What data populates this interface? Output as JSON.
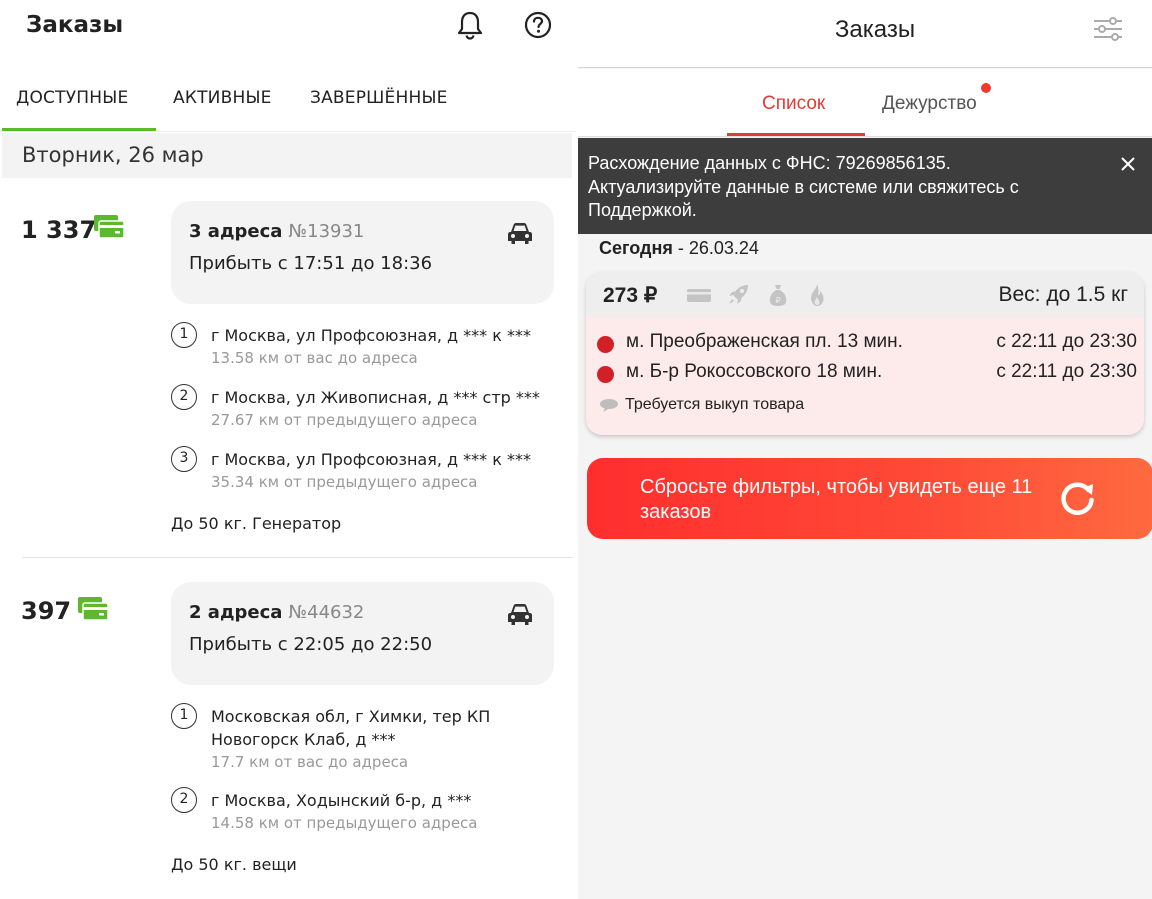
{
  "left": {
    "title": "Заказы",
    "tabs": [
      "ДОСТУПНЫЕ",
      "АКТИВНЫЕ",
      "ЗАВЕРШЁННЫЕ"
    ],
    "date": "Вторник, 26 мар",
    "orders": [
      {
        "price": "1 337",
        "addresses_label": "3 адреса",
        "number": "№13931",
        "arrive": "Прибыть с 17:51 до 18:36",
        "stops": [
          {
            "num": "1",
            "address": "г Москва, ул Профсоюзная, д *** к ***",
            "distance": "13.58 км от вас до адреса"
          },
          {
            "num": "2",
            "address": "г Москва, ул Живописная, д *** стр ***",
            "distance": "27.67 км от предыдущего адреса"
          },
          {
            "num": "3",
            "address": "г Москва, ул Профсоюзная, д *** к ***",
            "distance": "35.34 км от предыдущего адреса"
          }
        ],
        "note": "До 50 кг. Генератор"
      },
      {
        "price": "397",
        "addresses_label": "2 адреса",
        "number": "№44632",
        "arrive": "Прибыть с 22:05 до 22:50",
        "stops": [
          {
            "num": "1",
            "address": "Московская обл, г Химки, тер КП Новогорск Клаб, д ***",
            "distance": "17.7 км от вас до адреса"
          },
          {
            "num": "2",
            "address": "г Москва, Ходынский б-р, д ***",
            "distance": "14.58 км от предыдущего адреса"
          }
        ],
        "note": "До 50 кг. вещи"
      }
    ]
  },
  "right": {
    "title": "Заказы",
    "tabs": {
      "list": "Список",
      "duty": "Дежурство"
    },
    "banner": "Расхождение данных с ФНС: 79269856135. Актуализируйте данные в системе или свяжитесь с Поддержкой.",
    "today_label": "Сегодня",
    "today_date": " - 26.03.24",
    "card": {
      "price": "273 ₽",
      "weight": "Вес: до 1.5 кг",
      "metros": [
        {
          "name": "м. Преображенская пл. 13 мин.",
          "time": "с 22:11 до 23:30"
        },
        {
          "name": "м. Б-р Рокоссовского 18 мин.",
          "time": "с 22:11 до 23:30"
        }
      ],
      "requirement": "Требуется выкуп товара"
    },
    "reset_text": "Сбросьте фильтры, чтобы увидеть еще 11 заказов"
  },
  "colors": {
    "green": "#5cb82e",
    "red": "#e53935",
    "banner": "#3d3d3d"
  }
}
